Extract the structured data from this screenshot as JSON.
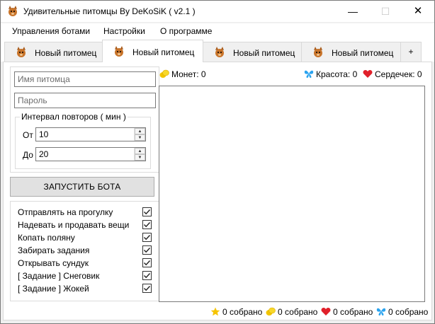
{
  "window": {
    "title": "Удивительные питомцы By DeKoSiK ( v2.1 )",
    "minimize": "—",
    "maximize": "☐",
    "close": "✕"
  },
  "menu": [
    "Управления ботами",
    "Настройки",
    "О программе"
  ],
  "tabs": [
    {
      "label": "Новый питомец",
      "icon": "pet-icon",
      "active": false
    },
    {
      "label": "Новый питомец",
      "icon": "pet-icon",
      "active": true
    },
    {
      "label": "Новый питомец",
      "icon": "pet-icon",
      "active": false
    },
    {
      "label": "Новый питомец",
      "icon": "pet-icon",
      "active": false
    }
  ],
  "tab_add": "+",
  "form": {
    "pet_name_placeholder": "Имя питомца",
    "password_placeholder": "Пароль",
    "interval_title": "Интервал повторов ( мин )",
    "from_label": "От",
    "from_value": "10",
    "to_label": "До",
    "to_value": "20",
    "start_button": "ЗАПУСТИТЬ БОТА"
  },
  "options": [
    {
      "label": "Отправлять на прогулку",
      "checked": true
    },
    {
      "label": "Надевать и продавать вещи",
      "checked": true
    },
    {
      "label": "Копать поляну",
      "checked": true
    },
    {
      "label": "Забирать задания",
      "checked": true
    },
    {
      "label": "Открывать сундук",
      "checked": true
    },
    {
      "label": "[ Задание ] Снеговик",
      "checked": true
    },
    {
      "label": "[ Задание ] Жокей",
      "checked": true
    }
  ],
  "stats": {
    "coins": "Монет: 0",
    "beauty": "Красота: 0",
    "hearts": "Сердечек: 0"
  },
  "footer": {
    "stars": "0 собрано",
    "coins": "0 собрано",
    "hearts": "0 собрано",
    "butterflies": "0 собрано"
  },
  "colors": {
    "coin": "#f2c500",
    "heart": "#e0202a",
    "butterfly": "#2aa3ef",
    "star": "#f6c400",
    "pet": "#c8742a"
  }
}
